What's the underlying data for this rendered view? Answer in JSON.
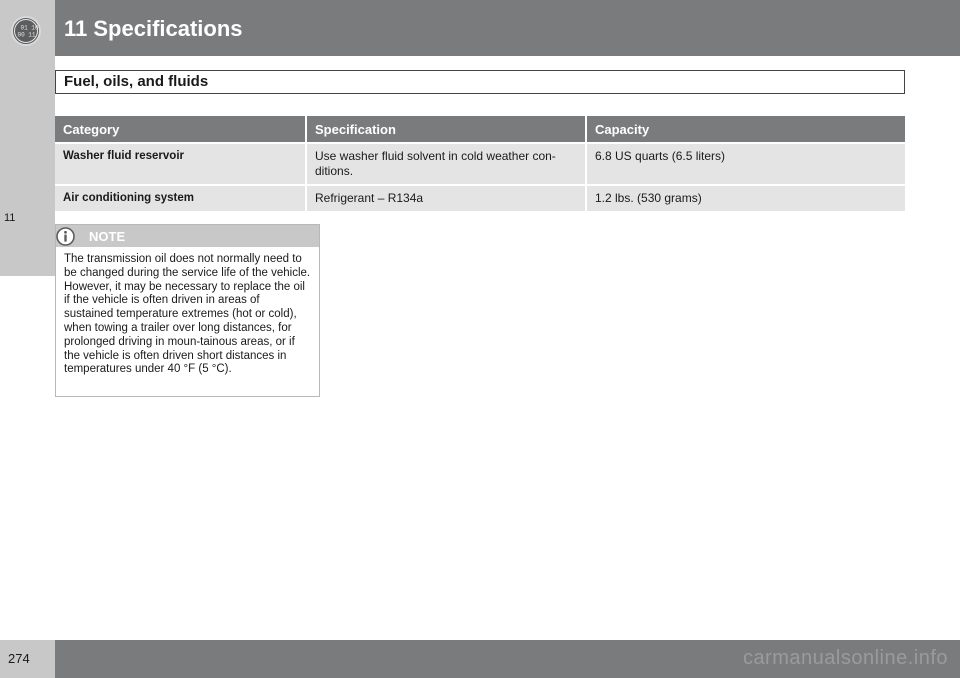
{
  "header": {
    "title": "11 Specifications",
    "icon": "chapter-gauge-icon"
  },
  "side_tab": {
    "chapter_number": "11"
  },
  "section": {
    "heading": "Fuel, oils, and fluids"
  },
  "table": {
    "headers": [
      "Category",
      "Specification",
      "Capacity"
    ],
    "rows": [
      {
        "category": "Washer fluid reservoir",
        "specification": "Use washer fluid solvent in cold weather con-ditions.",
        "capacity": "6.8 US quarts (6.5 liters)"
      },
      {
        "category": "Air conditioning system",
        "specification": "Refrigerant – R134a",
        "capacity": "1.2 lbs. (530 grams)"
      }
    ]
  },
  "note": {
    "label": "NOTE",
    "icon": "info-icon",
    "text": "The transmission oil does not normally need to be changed during the service life of the vehicle. However, it may be necessary to replace the oil if the vehicle is often driven in areas of sustained temperature extremes (hot or cold), when towing a trailer over long distances, for prolonged driving in moun-tainous areas, or if the vehicle is often driven short distances in temperatures under 40 °F (5 °C)."
  },
  "footer": {
    "page_number": "274",
    "watermark": "carmanualsonline.info"
  },
  "colors": {
    "bar_gray": "#7a7b7d",
    "tab_gray": "#c8c8c8",
    "cell_gray": "#e4e4e5"
  }
}
